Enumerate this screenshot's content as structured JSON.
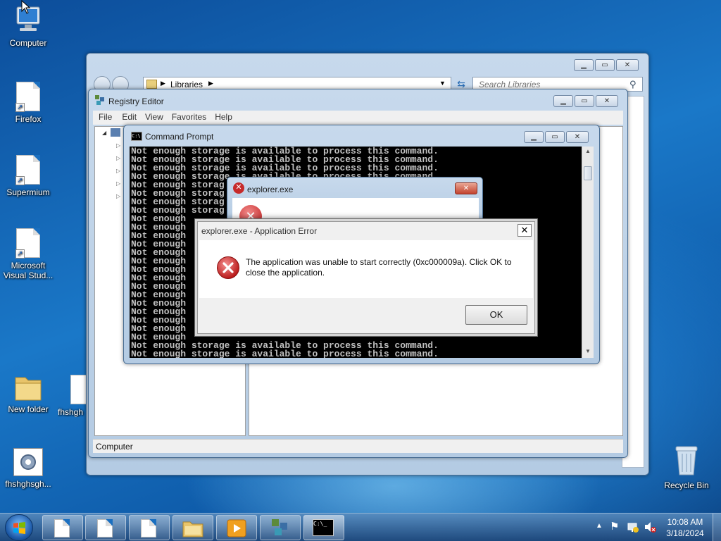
{
  "desktop": {
    "icons": [
      {
        "label": "Computer"
      },
      {
        "label": "Firefox"
      },
      {
        "label": "Supermium"
      },
      {
        "label": "Microsoft Visual Stud..."
      },
      {
        "label": "New folder"
      },
      {
        "label": "fhshgh"
      },
      {
        "label": "fhshghsgh..."
      },
      {
        "label": "Recycle Bin"
      }
    ]
  },
  "explorer": {
    "breadcrumb": "Libraries",
    "search_placeholder": "Search Libraries"
  },
  "regedit": {
    "title": "Registry Editor",
    "menu": [
      "File",
      "Edit",
      "View",
      "Favorites",
      "Help"
    ],
    "status": "Computer"
  },
  "cmd": {
    "title": "Command Prompt",
    "lines": [
      "Not enough storage is available to process this command.",
      "Not enough storage is available to process this command.",
      "Not enough storage is available to process this command.",
      "Not enough storage is available to process this command.",
      "Not enough storag",
      "Not enough storag",
      "Not enough storag",
      "Not enough storag",
      "Not enough",
      "Not enough",
      "Not enough",
      "Not enough",
      "Not enough",
      "Not enough",
      "Not enough",
      "Not enough",
      "Not enough",
      "Not enough",
      "Not enough",
      "Not enough",
      "Not enough",
      "Not enough",
      "Not enough",
      "Not enough storage is available to process this command.",
      "Not enough storage is available to process this command."
    ]
  },
  "explorer_dialog": {
    "title": "explorer.exe"
  },
  "error_dialog": {
    "title": "explorer.exe - Application Error",
    "message": "The application was unable to start correctly (0xc000009a). Click OK to close the application.",
    "ok_label": "OK"
  },
  "taskbar": {
    "time": "10:08 AM",
    "date": "3/18/2024"
  }
}
